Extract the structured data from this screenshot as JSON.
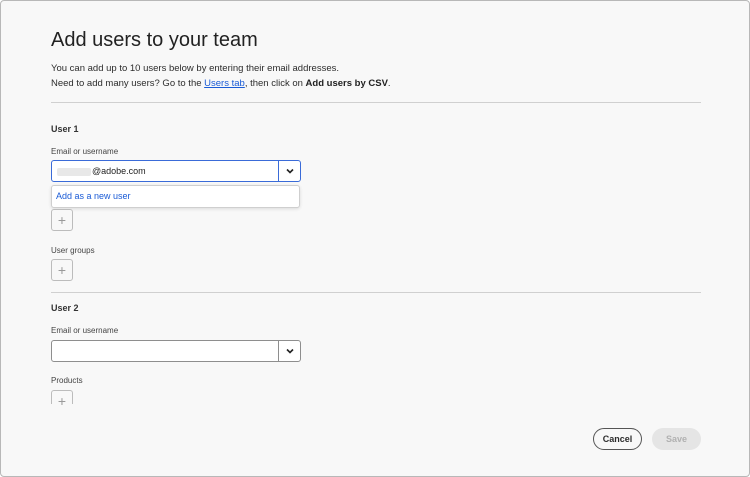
{
  "dialog": {
    "title": "Add users to your team",
    "intro_line1": "You can add up to 10 users below by entering their email addresses.",
    "intro_line2_prefix": "Need to add many users? Go to the ",
    "intro_link": "Users tab",
    "intro_line2_middle": ", then click on ",
    "intro_bold": "Add users by CSV",
    "intro_line2_suffix": "."
  },
  "user1": {
    "heading": "User 1",
    "email_label": "Email or username",
    "email_value": "@adobe.com",
    "suggestion": "Add as a new user",
    "groups_label": "User groups"
  },
  "user2": {
    "heading": "User 2",
    "email_label": "Email or username",
    "email_value": "",
    "products_label": "Products"
  },
  "footer": {
    "cancel_label": "Cancel",
    "save_label": "Save"
  },
  "icons": {
    "dropdown": "chevron-down-icon",
    "add": "plus-icon"
  },
  "colors": {
    "link": "#1a5bd6",
    "focus_border": "#3a6bd8",
    "disabled_text": "#b1b1b1"
  }
}
